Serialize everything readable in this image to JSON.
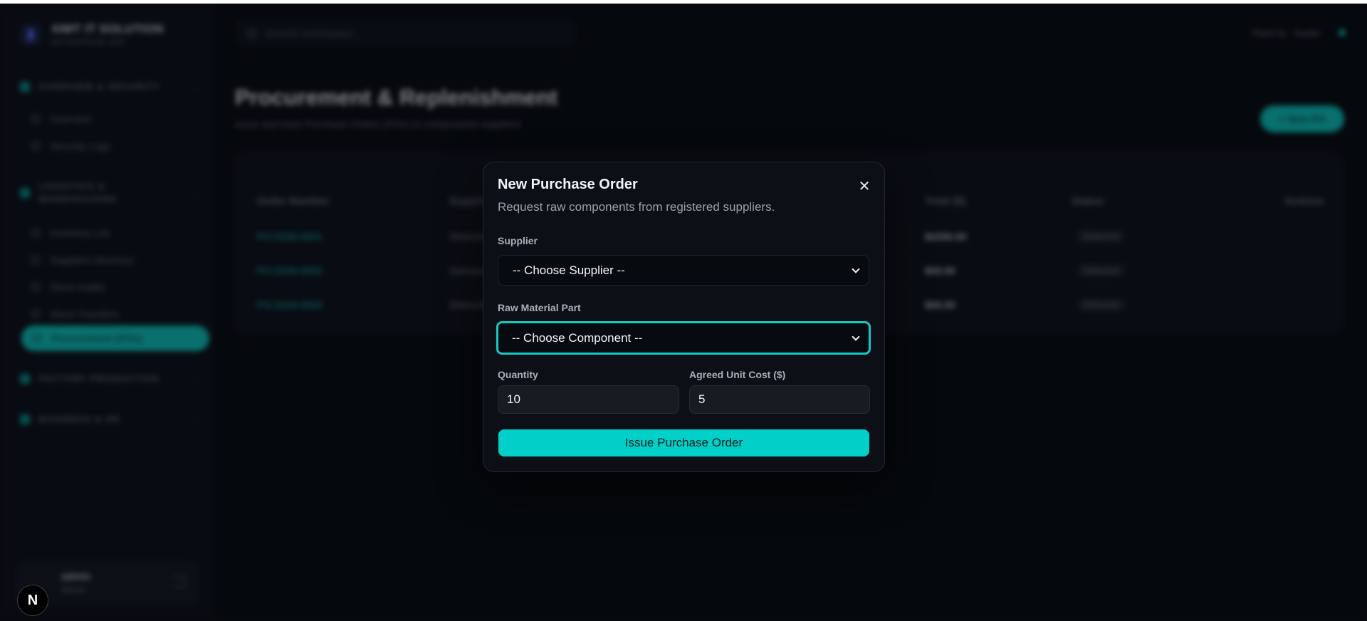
{
  "sidebar": {
    "brand_name": "XIMT IT SOLUTION",
    "brand_sub": "ENTERPRISE ERP",
    "groups": [
      {
        "label": "OVERVIEW & SECURITY",
        "items": [
          {
            "label": "Overview"
          },
          {
            "label": "Security Logs"
          }
        ]
      },
      {
        "label": "LOGISTICS & WAREHOUSING",
        "items": [
          {
            "label": "Inventory List"
          },
          {
            "label": "Suppliers Directory"
          },
          {
            "label": "Stock Audits"
          },
          {
            "label": "Stock Transfers"
          },
          {
            "label": "Procurement (POs)"
          }
        ]
      },
      {
        "label": "FACTORY PRODUCTION"
      },
      {
        "label": "BUSINESS & HR"
      }
    ],
    "user": {
      "name": "admin",
      "role": "Admin"
    }
  },
  "header": {
    "search_placeholder": "Search workspace...",
    "right_label": "Plant 01 · Austin"
  },
  "page": {
    "title": "Procurement & Replenishment",
    "subtitle": "Issue and track Purchase Orders (POs) to components suppliers.",
    "new_po_label": "+ New PO"
  },
  "table": {
    "headers": [
      "Order Number",
      "Supplier",
      "Total ($)",
      "Status",
      "Actions"
    ],
    "rows": [
      {
        "order": "PO-2026-0001",
        "supplier": "Shenzhen",
        "total": "$2250.00",
        "status": "Delivered"
      },
      {
        "order": "PO-2026-0002",
        "supplier": "Samsung",
        "total": "$50.00",
        "status": "Delivered"
      },
      {
        "order": "PO-2026-0003",
        "supplier": "Shenzhen",
        "total": "$50.00",
        "status": "Delivered"
      }
    ]
  },
  "modal": {
    "title": "New Purchase Order",
    "subtitle": "Request raw components from registered suppliers.",
    "close_symbol": "✕",
    "supplier_label": "Supplier",
    "supplier_value": "-- Choose Supplier --",
    "part_label": "Raw Material Part",
    "part_value": "-- Choose Component --",
    "quantity_label": "Quantity",
    "quantity_value": "10",
    "cost_label": "Agreed Unit Cost ($)",
    "cost_value": "5",
    "submit_label": "Issue Purchase Order"
  },
  "next_badge": "N",
  "colors": {
    "accent": "#00d0c8",
    "background": "#080b10",
    "modal": "#0c1016"
  }
}
